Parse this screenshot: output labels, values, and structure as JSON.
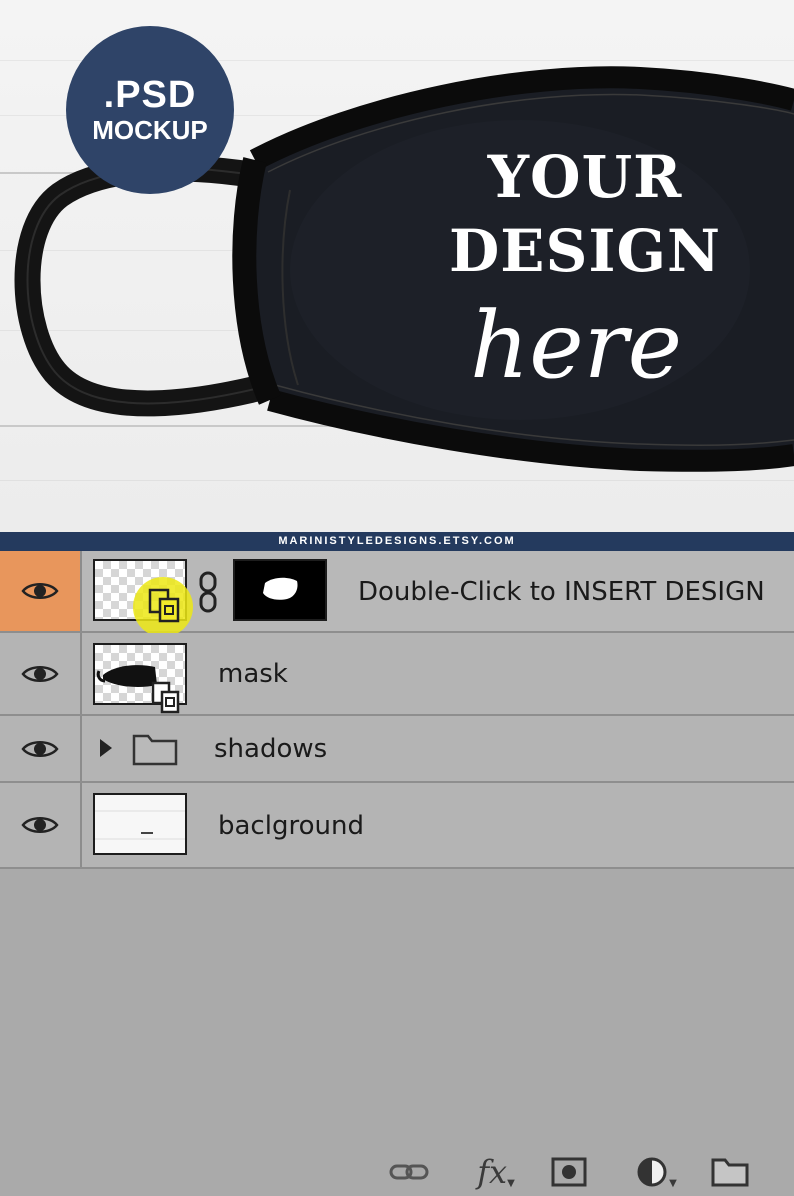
{
  "badge": {
    "line1": ".PSD",
    "line2": "MOCKUP"
  },
  "design": {
    "line1": "YOUR",
    "line2": "DESIGN",
    "script": "here"
  },
  "banner": {
    "text": "MARINISTYLEDESIGNS.ETSY.COM"
  },
  "colors": {
    "badge": "#2f4468",
    "banner": "#243a5e",
    "selected_eye_cell": "#e8965c",
    "panel": "#b4b4b4",
    "smart_badge": "#ece814"
  },
  "layers": [
    {
      "name": "Double-Click to INSERT DESIGN",
      "visible": true,
      "selected": true,
      "icon": "smart-object-icon"
    },
    {
      "name": "mask",
      "visible": true,
      "selected": false,
      "icon": "smart-object-icon"
    },
    {
      "name": "shadows",
      "visible": true,
      "selected": false,
      "icon": "folder-icon"
    },
    {
      "name": "baclground",
      "visible": true,
      "selected": false,
      "icon": "layer-thumbnail"
    }
  ],
  "toolbar": {
    "fx_label": "fx",
    "icons": [
      "link-icon",
      "fx-icon",
      "add-mask-icon",
      "adjustment-icon",
      "new-group-icon"
    ]
  }
}
